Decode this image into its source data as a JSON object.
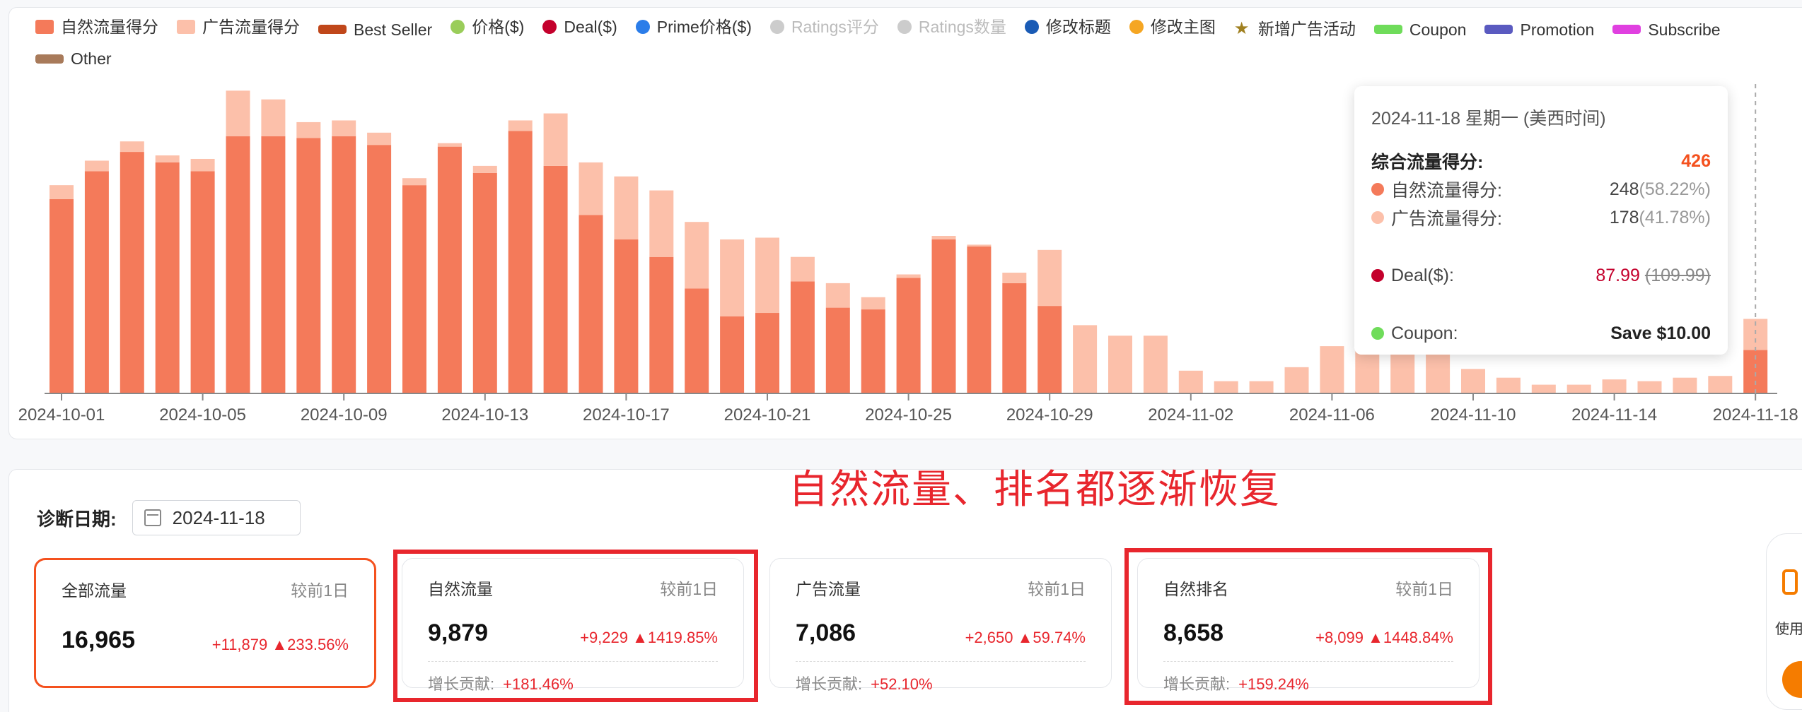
{
  "legend": [
    {
      "label": "自然流量得分",
      "color": "#f47a5a",
      "shape": "rect",
      "active": true
    },
    {
      "label": "广告流量得分",
      "color": "#fcc0aa",
      "shape": "rect",
      "active": true
    },
    {
      "label": "Best Seller",
      "color": "#c0471a",
      "shape": "bar",
      "active": true
    },
    {
      "label": "价格($)",
      "color": "#9acd5a",
      "shape": "dot",
      "active": true
    },
    {
      "label": "Deal($)",
      "color": "#c4002c",
      "shape": "dot",
      "active": true
    },
    {
      "label": "Prime价格($)",
      "color": "#2b7de9",
      "shape": "dot",
      "active": true
    },
    {
      "label": "Ratings评分",
      "color": "#cccccc",
      "shape": "dot",
      "active": false
    },
    {
      "label": "Ratings数量",
      "color": "#cccccc",
      "shape": "dot",
      "active": false
    },
    {
      "label": "修改标题",
      "color": "#1a5bb5",
      "shape": "dot",
      "active": true
    },
    {
      "label": "修改主图",
      "color": "#f5a623",
      "shape": "dot",
      "active": true
    },
    {
      "label": "新增广告活动",
      "color": "#a08020",
      "shape": "star",
      "active": true
    },
    {
      "label": "Coupon",
      "color": "#6fdc5a",
      "shape": "bar",
      "active": true
    },
    {
      "label": "Promotion",
      "color": "#5a5ac0",
      "shape": "bar",
      "active": true
    },
    {
      "label": "Subscribe",
      "color": "#e040e0",
      "shape": "bar",
      "active": true
    },
    {
      "label": "Other",
      "color": "#a87a5a",
      "shape": "bar",
      "active": true
    }
  ],
  "chart_data": {
    "type": "bar",
    "x_ticks": [
      "2024-10-01",
      "2024-10-05",
      "2024-10-09",
      "2024-10-13",
      "2024-10-17",
      "2024-10-21",
      "2024-10-25",
      "2024-10-29",
      "2024-11-02",
      "2024-11-06",
      "2024-11-10",
      "2024-11-14",
      "2024-11-18"
    ],
    "categories": [
      "2024-10-01",
      "2024-10-02",
      "2024-10-03",
      "2024-10-04",
      "2024-10-05",
      "2024-10-06",
      "2024-10-07",
      "2024-10-08",
      "2024-10-09",
      "2024-10-10",
      "2024-10-11",
      "2024-10-12",
      "2024-10-13",
      "2024-10-14",
      "2024-10-15",
      "2024-10-16",
      "2024-10-17",
      "2024-10-18",
      "2024-10-19",
      "2024-10-20",
      "2024-10-21",
      "2024-10-22",
      "2024-10-23",
      "2024-10-24",
      "2024-10-25",
      "2024-10-26",
      "2024-10-27",
      "2024-10-28",
      "2024-10-29",
      "2024-10-30",
      "2024-10-31",
      "2024-11-01",
      "2024-11-02",
      "2024-11-03",
      "2024-11-04",
      "2024-11-05",
      "2024-11-06",
      "2024-11-07",
      "2024-11-08",
      "2024-11-09",
      "2024-11-10",
      "2024-11-11",
      "2024-11-12",
      "2024-11-13",
      "2024-11-14",
      "2024-11-15",
      "2024-11-16",
      "2024-11-17",
      "2024-11-18"
    ],
    "ylim": [
      0,
      1800
    ],
    "series": [
      {
        "name": "自然流量得分",
        "color": "#f47a5a",
        "values": [
          1110,
          1270,
          1380,
          1320,
          1270,
          1470,
          1470,
          1460,
          1470,
          1420,
          1190,
          1410,
          1260,
          1500,
          1300,
          1020,
          880,
          780,
          600,
          440,
          460,
          640,
          490,
          480,
          660,
          880,
          840,
          630,
          500,
          0,
          0,
          0,
          0,
          0,
          0,
          0,
          0,
          0,
          0,
          0,
          0,
          0,
          0,
          0,
          0,
          0,
          0,
          0,
          248
        ]
      },
      {
        "name": "广告流量得分",
        "color": "#fcc0aa",
        "values": [
          80,
          60,
          60,
          40,
          70,
          260,
          210,
          90,
          90,
          70,
          40,
          20,
          40,
          60,
          300,
          300,
          360,
          380,
          380,
          440,
          430,
          140,
          140,
          70,
          20,
          20,
          10,
          60,
          320,
          390,
          330,
          330,
          130,
          70,
          70,
          150,
          270,
          260,
          260,
          270,
          140,
          90,
          50,
          50,
          80,
          70,
          90,
          100,
          178
        ]
      }
    ]
  },
  "tooltip": {
    "title": "2024-11-18 星期一 (美西时间)",
    "total_label": "综合流量得分:",
    "total_value": "426",
    "organic_label": "自然流量得分:",
    "organic_value": "248",
    "organic_pct": "(58.22%)",
    "ad_label": "广告流量得分:",
    "ad_value": "178",
    "ad_pct": "(41.78%)",
    "deal_label": "Deal($):",
    "deal_value": "87.99",
    "deal_old": "(109.99)",
    "coupon_label": "Coupon:",
    "coupon_value": "Save $10.00"
  },
  "annotation": "自然流量、排名都逐渐恢复",
  "diagnosis": {
    "label": "诊断日期:",
    "date": "2024-11-18"
  },
  "kpis": [
    {
      "title": "全部流量",
      "cmp": "较前1日",
      "value": "16,965",
      "change": "+11,879",
      "pct": "233.56%",
      "contrib_label": "",
      "contrib": ""
    },
    {
      "title": "自然流量",
      "cmp": "较前1日",
      "value": "9,879",
      "change": "+9,229",
      "pct": "1419.85%",
      "contrib_label": "增长贡献:",
      "contrib": "+181.46%"
    },
    {
      "title": "广告流量",
      "cmp": "较前1日",
      "value": "7,086",
      "change": "+2,650",
      "pct": "59.74%",
      "contrib_label": "增长贡献:",
      "contrib": "+52.10%"
    },
    {
      "title": "自然排名",
      "cmp": "较前1日",
      "value": "8,658",
      "change": "+8,099",
      "pct": "1448.84%",
      "contrib_label": "增长贡献:",
      "contrib": "+159.24%"
    }
  ],
  "side_widget": {
    "label": "使用"
  }
}
